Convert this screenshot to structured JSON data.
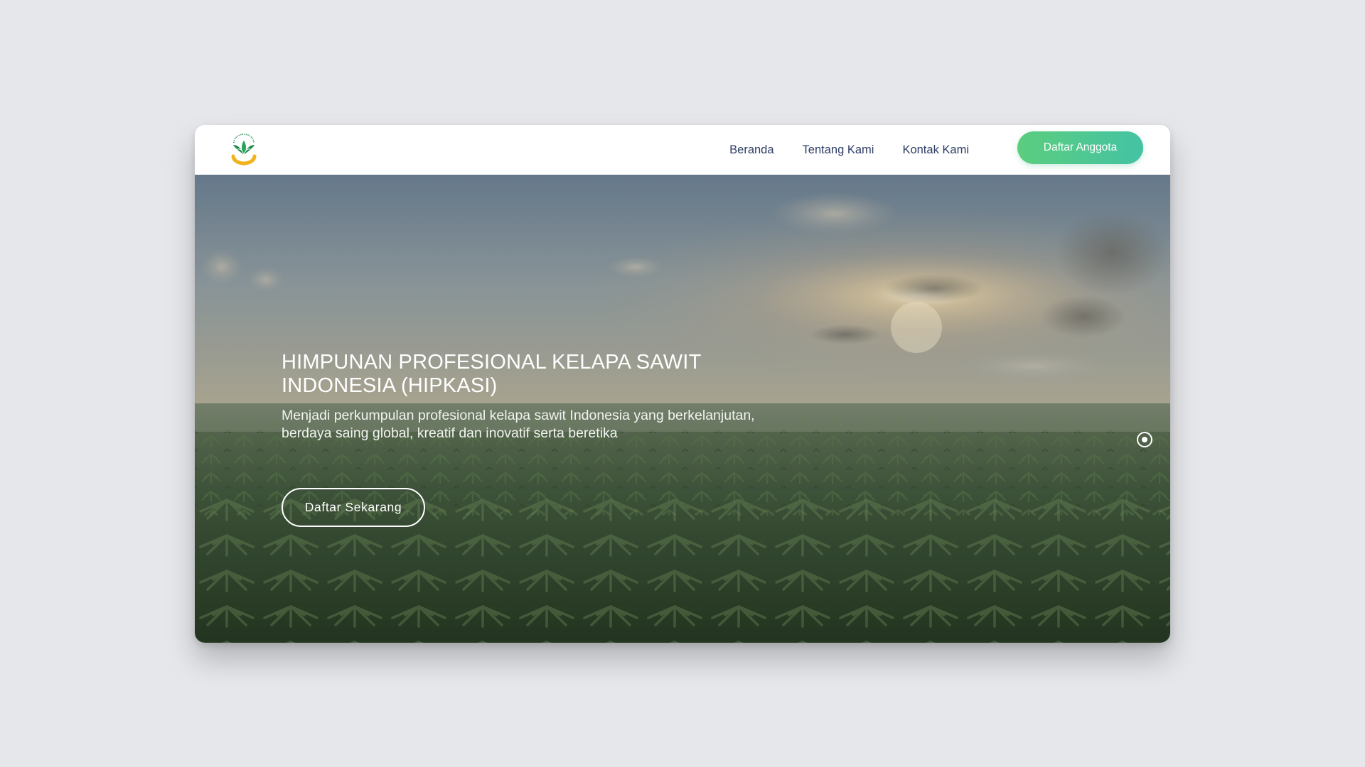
{
  "header": {
    "logo_icon": "hipkasi-logo-icon",
    "nav": [
      {
        "label": "Beranda"
      },
      {
        "label": "Tentang Kami"
      },
      {
        "label": "Kontak Kami"
      }
    ],
    "cta_label": "Daftar Anggota"
  },
  "hero": {
    "title": "HIMPUNAN PROFESIONAL KELAPA SAWIT INDONESIA (HIPKASI)",
    "subtitle": "Menjadi perkumpulan profesional kelapa sawit Indonesia yang berkelanjutan, berdaya saing global, kreatif dan inovatif serta beretika",
    "cta_label": "Daftar Sekarang",
    "background_icon": "palm-plantation-sunset-image",
    "slider_active_index": 0
  },
  "colors": {
    "page_background": "#e6e7eb",
    "nav_text": "#2f3e66",
    "cta_gradient_start": "#5ccd7e",
    "cta_gradient_end": "#44c3a4",
    "logo_green": "#1f8a4c",
    "logo_gold": "#f2b21c"
  }
}
